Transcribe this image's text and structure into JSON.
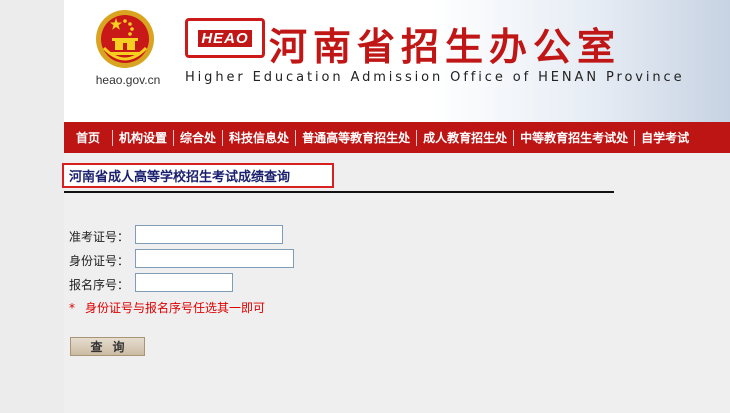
{
  "header": {
    "site_url": "heao.gov.cn",
    "logo_text": "HEAO",
    "title_cn": "河南省招生办公室",
    "title_en": "Higher Education Admission Office of HENAN Province"
  },
  "nav": {
    "items": [
      "首页",
      "机构设置",
      "综合处",
      "科技信息处",
      "普通高等教育招生处",
      "成人教育招生处",
      "中等教育招生考试处",
      "自学考试"
    ]
  },
  "page": {
    "heading": "河南省成人高等学校招生考试成绩查询"
  },
  "form": {
    "ticket_label": "准考证号：",
    "ticket_value": "",
    "id_label": "身份证号：",
    "id_value": "",
    "reg_label": "报名序号：",
    "reg_value": "",
    "note_star": "*",
    "note_text": "身份证号与报名序号任选其一即可",
    "submit_label": "查询"
  },
  "colors": {
    "brand_red": "#bd1414",
    "title_navy": "#1a1f6e",
    "note_red": "#dd0000"
  }
}
